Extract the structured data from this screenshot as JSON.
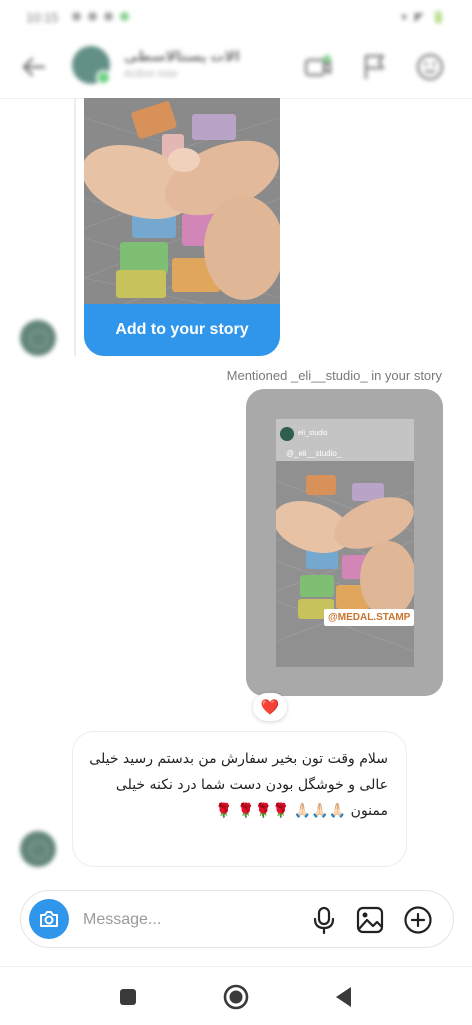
{
  "status_bar": {
    "time": "10:15",
    "right_indicators": "▾ ◤ 🔋"
  },
  "header": {
    "contact_name": "الات پستالاسطی",
    "contact_status": "Active now",
    "avatar_color": "#2f6b5e"
  },
  "shared_story": {
    "button_label": "Add to your story",
    "accent": "#2f96ec"
  },
  "mention_text": "Mentioned _eli__studio_ in your story",
  "reply_story": {
    "account_tag": "eli_studio",
    "handle_sticker": "@_eli__studio_",
    "tag_label": "@MEDAL.STAMP"
  },
  "reaction": {
    "emoji": "❤️"
  },
  "message": {
    "text": "سلام وقت تون بخیر سفارش من بدستم رسید خیلی عالی و خوشگل بودن دست شما درد نکنه خیلی ممنون 🙏🏻🙏🏻🙏🏻 🌹🌹🌹 🌹"
  },
  "composer": {
    "placeholder": "Message...",
    "icons": [
      "camera-icon",
      "microphone-icon",
      "gallery-icon",
      "add-icon"
    ]
  },
  "nav": {
    "icons": [
      "recents-square-icon",
      "home-circle-icon",
      "back-triangle-icon"
    ]
  }
}
